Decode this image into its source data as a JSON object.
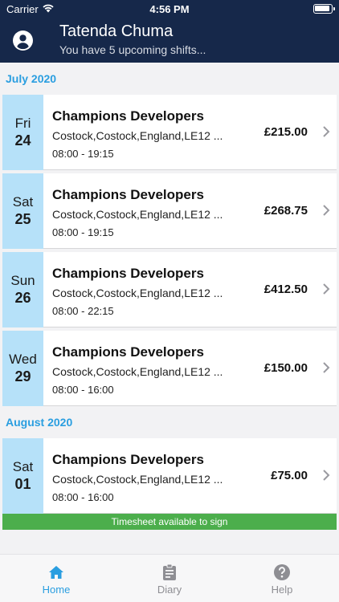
{
  "status_bar": {
    "carrier": "Carrier",
    "time": "4:56 PM"
  },
  "header": {
    "name": "Tatenda Chuma",
    "subtitle": "You have 5 upcoming shifts..."
  },
  "groups": [
    {
      "month": "July 2020",
      "shifts": [
        {
          "dow": "Fri",
          "day": "24",
          "company": "Champions Developers",
          "address": "Costock,Costock,England,LE12 ...",
          "hours": "08:00 - 19:15",
          "price": "£215.00"
        },
        {
          "dow": "Sat",
          "day": "25",
          "company": "Champions Developers",
          "address": "Costock,Costock,England,LE12 ...",
          "hours": "08:00 - 19:15",
          "price": "£268.75"
        },
        {
          "dow": "Sun",
          "day": "26",
          "company": "Champions Developers",
          "address": "Costock,Costock,England,LE12 ...",
          "hours": "08:00 - 22:15",
          "price": "£412.50"
        },
        {
          "dow": "Wed",
          "day": "29",
          "company": "Champions Developers",
          "address": "Costock,Costock,England,LE12 ...",
          "hours": "08:00 - 16:00",
          "price": "£150.00"
        }
      ]
    },
    {
      "month": "August 2020",
      "shifts": [
        {
          "dow": "Sat",
          "day": "01",
          "company": "Champions Developers",
          "address": "Costock,Costock,England,LE12 ...",
          "hours": "08:00 - 16:00",
          "price": "£75.00",
          "timesheet": "Timesheet available to sign"
        }
      ]
    }
  ],
  "tabbar": {
    "home": "Home",
    "diary": "Diary",
    "help": "Help"
  },
  "colors": {
    "header_bg": "#16284a",
    "accent": "#2a9ee0",
    "date_bg": "#b6e1f9",
    "timesheet_bg": "#4cae4c"
  },
  "icons": {
    "profile": "user-circle-icon",
    "home": "home-icon",
    "diary": "clipboard-icon",
    "help": "help-circle-icon"
  }
}
